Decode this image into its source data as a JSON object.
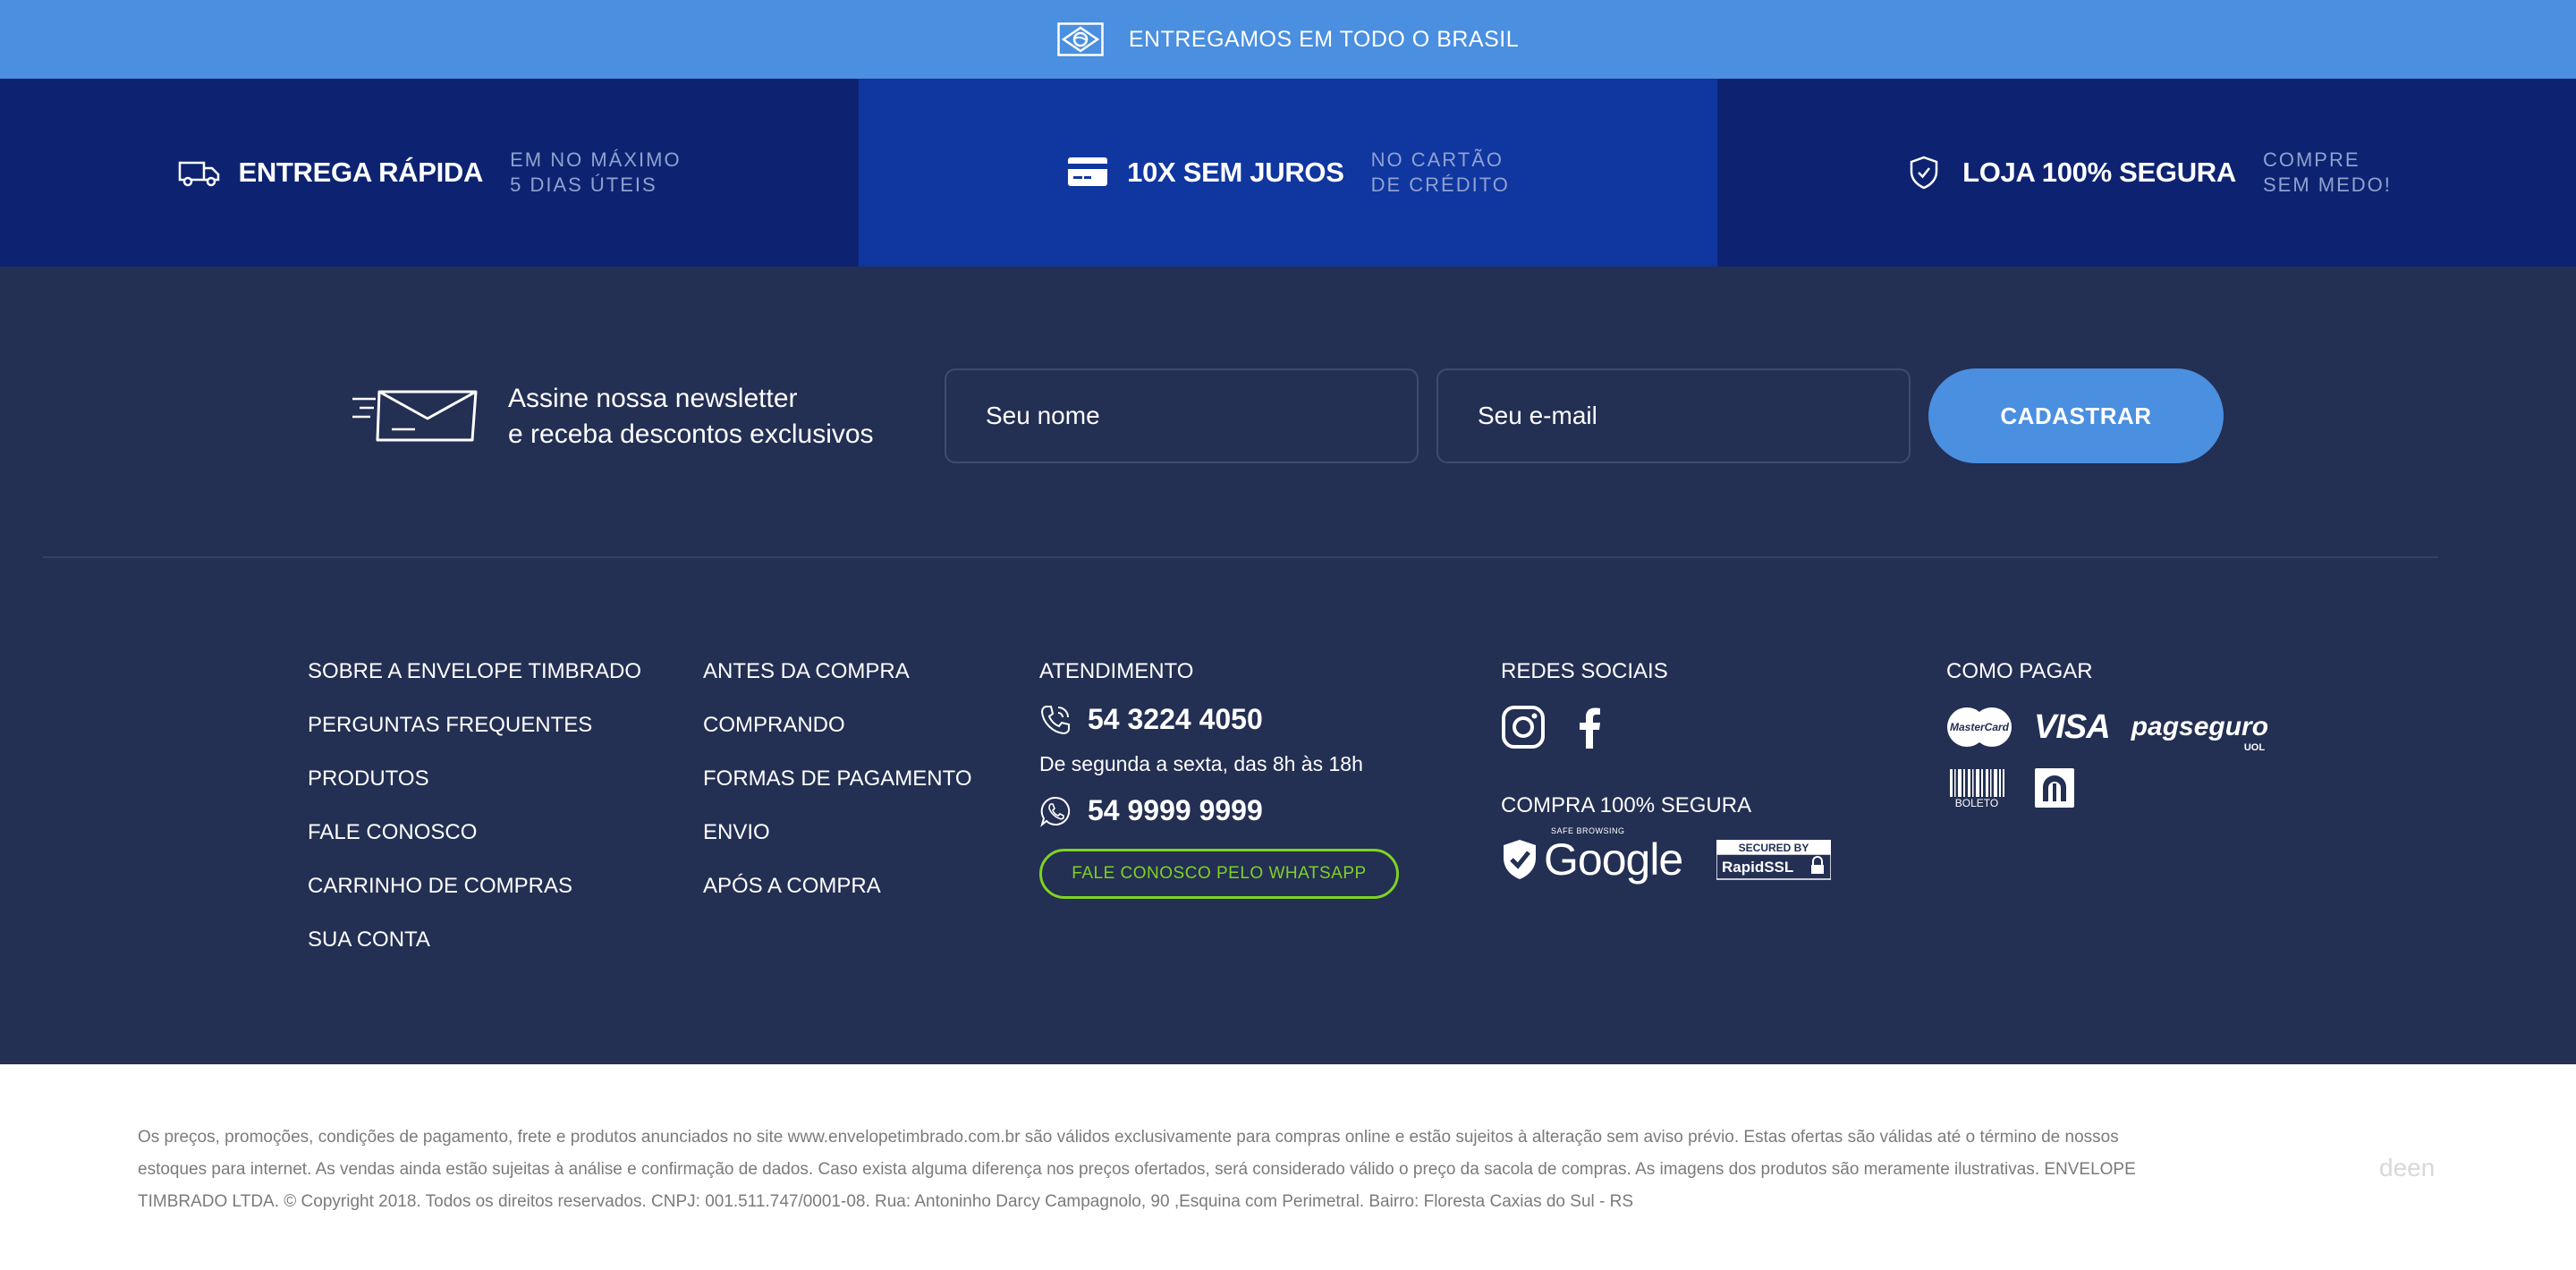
{
  "topbar": {
    "text": "ENTREGAMOS EM TODO O BRASIL",
    "icon": "brazil-flag-icon",
    "background": "#4a8fe0"
  },
  "benefits": [
    {
      "icon": "delivery-truck-icon",
      "title": "ENTREGA RÁPIDA",
      "sub1": "EM NO MÁXIMO",
      "sub2": "5 DIAS ÚTEIS"
    },
    {
      "icon": "credit-card-icon",
      "title": "10X SEM JUROS",
      "sub1": "NO CARTÃO",
      "sub2": "DE CRÉDITO"
    },
    {
      "icon": "shield-check-icon",
      "title": "LOJA 100% SEGURA",
      "sub1": "COMPRE",
      "sub2": "SEM MEDO!"
    }
  ],
  "newsletter": {
    "line1": "Assine nossa newsletter",
    "line2": "e receba descontos exclusivos",
    "name_placeholder": "Seu nome",
    "email_placeholder": "Seu e-mail",
    "submit_label": "CADASTRAR"
  },
  "links_col1": [
    "SOBRE A ENVELOPE TIMBRADO",
    "PERGUNTAS FREQUENTES",
    "PRODUTOS",
    "FALE CONOSCO",
    "CARRINHO DE COMPRAS",
    "SUA CONTA"
  ],
  "links_col2": [
    "ANTES DA COMPRA",
    "COMPRANDO",
    "FORMAS DE PAGAMENTO",
    "ENVIO",
    "APÓS A COMPRA"
  ],
  "atendimento": {
    "title": "ATENDIMENTO",
    "phone": "54 3224 4050",
    "hours": "De segunda a sexta, das 8h às 18h",
    "whatsapp": "54 9999 9999",
    "whatsapp_button": "FALE CONOSCO PELO WHATSAPP"
  },
  "social": {
    "title": "REDES SOCIAIS",
    "icons": [
      "instagram-icon",
      "facebook-icon"
    ],
    "secure_title": "COMPRA 100% SEGURA",
    "google_small": "SAFE BROWSING",
    "google_text": "Google",
    "rapidssl_top": "SECURED BY",
    "rapidssl_bottom": "RapidSSL"
  },
  "payment": {
    "title": "COMO PAGAR",
    "mastercard": "MasterCard",
    "visa": "VISA",
    "pagseguro": "pagseguro",
    "pagseguro_small": "UOL",
    "boleto": "BOLETO"
  },
  "legal": {
    "text": "Os preços, promoções, condições de pagamento, frete e produtos anunciados no site www.envelopetimbrado.com.br são válidos exclusivamente para compras online e estão sujeitos à alteração sem aviso prévio. Estas ofertas são válidas até o término de nossos estoques para internet.  As vendas ainda estão sujeitas à análise e confirmação de dados. Caso exista alguma diferença nos preços ofertados, será considerado válido o preço da sacola de compras. As imagens dos produtos são meramente ilustrativas.  ENVELOPE TIMBRADO LTDA. © Copyright 2018. Todos os direitos reservados. CNPJ: 001.511.747/0001-08. Rua: Antoninho Darcy Campagnolo, 90 ,Esquina com Perimetral. Bairro: Floresta Caxias do Sul - RS",
    "brand": "deen"
  },
  "colors": {
    "benefit_dark": "#0d2371",
    "benefit_mid": "#1036a0",
    "footer_bg": "#232f53",
    "accent_blue": "#4a8fe0",
    "whatsapp_green": "#7ed321"
  }
}
